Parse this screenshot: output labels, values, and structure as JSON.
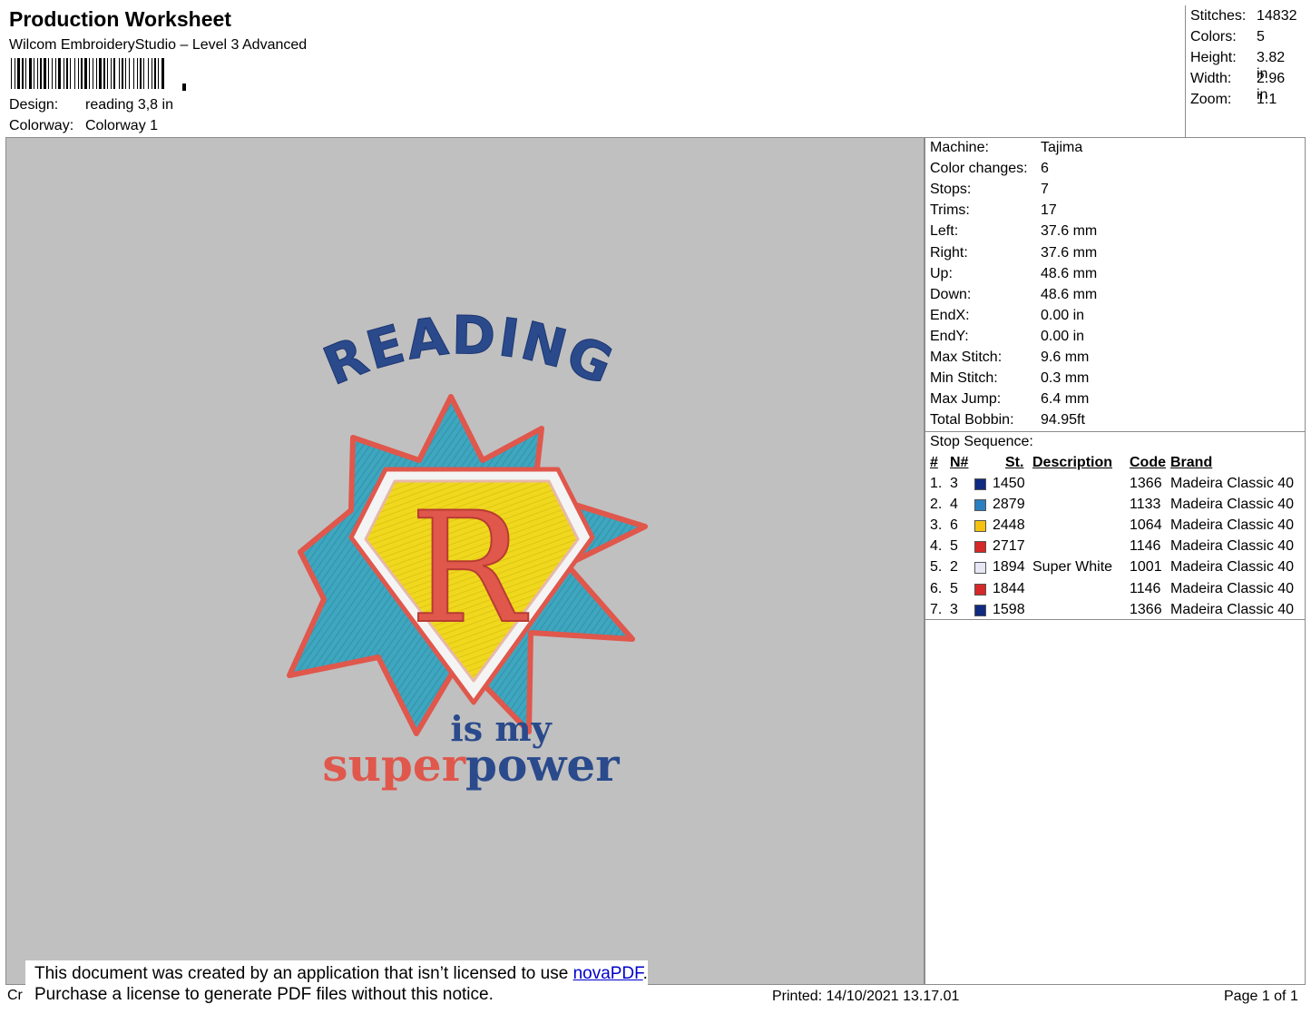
{
  "header": {
    "title": "Production Worksheet",
    "subtitle": "Wilcom EmbroideryStudio – Level 3 Advanced",
    "design_label": "Design:",
    "design_value": "reading 3,8 in",
    "colorway_label": "Colorway:",
    "colorway_value": "Colorway 1"
  },
  "stats": [
    {
      "label": "Stitches:",
      "value": "14832"
    },
    {
      "label": "Colors:",
      "value": "5"
    },
    {
      "label": "Height:",
      "value": "3.82 in"
    },
    {
      "label": "Width:",
      "value": "2.96 in"
    },
    {
      "label": "Zoom:",
      "value": "1:1"
    }
  ],
  "design_text": {
    "top_word": "READING",
    "monogram": "R",
    "line2": "is my",
    "line3a": "super",
    "line3b": "power"
  },
  "colors": {
    "navy": "#2a4a8c",
    "red": "#e0574c",
    "teal": "#3ea6bf",
    "yellow": "#f0d81e",
    "white": "#f4f4f4",
    "canvas": "#c0c0c0"
  },
  "machine_info": [
    {
      "label": "Machine:",
      "value": "Tajima"
    },
    {
      "label": "Color changes:",
      "value": "6"
    },
    {
      "label": "Stops:",
      "value": "7"
    },
    {
      "label": "Trims:",
      "value": "17"
    },
    {
      "label": "Left:",
      "value": "37.6 mm"
    },
    {
      "label": "Right:",
      "value": "37.6 mm"
    },
    {
      "label": "Up:",
      "value": "48.6 mm"
    },
    {
      "label": "Down:",
      "value": "48.6 mm"
    },
    {
      "label": "EndX:",
      "value": "0.00 in"
    },
    {
      "label": "EndY:",
      "value": "0.00 in"
    },
    {
      "label": "Max Stitch:",
      "value": "9.6 mm"
    },
    {
      "label": "Min Stitch:",
      "value": "0.3 mm"
    },
    {
      "label": "Max Jump:",
      "value": "6.4 mm"
    },
    {
      "label": "Total Bobbin:",
      "value": "94.95ft"
    }
  ],
  "stop_sequence": {
    "title": "Stop Sequence:",
    "headers": {
      "num": "#",
      "n": "N#",
      "st": "St.",
      "desc": "Description",
      "code": "Code",
      "brand": "Brand"
    },
    "rows": [
      {
        "num": "1.",
        "n": "3",
        "color": "#0f2a80",
        "st": "1450",
        "desc": "",
        "code": "1366",
        "brand": "Madeira Classic 40"
      },
      {
        "num": "2.",
        "n": "4",
        "color": "#2a7fc0",
        "st": "2879",
        "desc": "",
        "code": "1133",
        "brand": "Madeira Classic 40"
      },
      {
        "num": "3.",
        "n": "6",
        "color": "#f5c20f",
        "st": "2448",
        "desc": "",
        "code": "1064",
        "brand": "Madeira Classic 40"
      },
      {
        "num": "4.",
        "n": "5",
        "color": "#d62828",
        "st": "2717",
        "desc": "",
        "code": "1146",
        "brand": "Madeira Classic 40"
      },
      {
        "num": "5.",
        "n": "2",
        "color": "#e6e6f5",
        "st": "1894",
        "desc": "Super White",
        "code": "1001",
        "brand": "Madeira Classic 40"
      },
      {
        "num": "6.",
        "n": "5",
        "color": "#d62828",
        "st": "1844",
        "desc": "",
        "code": "1146",
        "brand": "Madeira Classic 40"
      },
      {
        "num": "7.",
        "n": "3",
        "color": "#0f2a80",
        "st": "1598",
        "desc": "",
        "code": "1366",
        "brand": "Madeira Classic 40"
      }
    ]
  },
  "footer": {
    "left_text": "Cr",
    "printed": "Printed: 14/10/2021 13.17.01",
    "page": "Page 1 of 1",
    "notice_line1_a": "This document was created by an application that isn’t licensed to use ",
    "notice_link": "novaPDF",
    "notice_line1_b": ".",
    "notice_line2": "Purchase a license to generate PDF files without this notice."
  }
}
